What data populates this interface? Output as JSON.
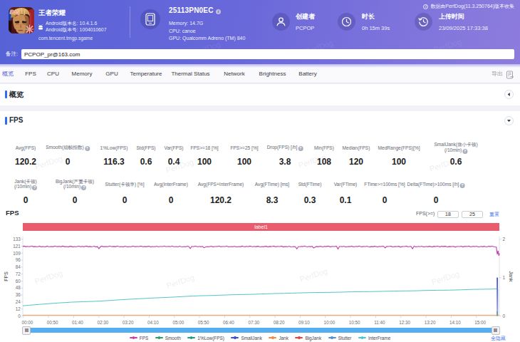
{
  "header": {
    "collect_info": "数据由PerfDog(11.3.250764)版本收集",
    "app": {
      "name": "王者荣耀",
      "version_name_label": "Android版本名: ",
      "version_name": "10.4.1.6",
      "version_code_label": "Android版本号: ",
      "version_code": "1004010607",
      "package": "com.tencent.tmgp.sgame"
    },
    "device": {
      "model": "25113PN0EC",
      "info_badge": "i",
      "memory": "Memory: 14.7G",
      "cpu": "CPU: canoe",
      "gpu": "GPU: Qualcomm Adreno (TM) 840"
    },
    "creator": {
      "label": "创建者",
      "value": "PCPOP"
    },
    "duration": {
      "label": "时长",
      "value": "0h 15m 39s"
    },
    "upload": {
      "label": "上传时间",
      "value": "23/09/2025 17:33:38"
    },
    "remark": {
      "label": "备注:",
      "value": "PCPOP_pr@163.com"
    }
  },
  "nav": {
    "tabs": [
      "概览",
      "FPS",
      "CPU",
      "Memory",
      "GPU",
      "Temperature",
      "Thermal Status",
      "Network",
      "Brightness",
      "Battery"
    ],
    "active_index": 0,
    "export_label": "导出"
  },
  "sections": {
    "overview_title": "概览",
    "fps_title": "FPS"
  },
  "stats": {
    "row1": [
      {
        "label": "Avg(FPS)",
        "value": "120.2"
      },
      {
        "label": "Smooth(稳帧指数)",
        "help": true,
        "value": "0"
      },
      {
        "label": "1%Low(FPS)",
        "value": "116.3"
      },
      {
        "label": "Std(FPS)",
        "value": "0.6"
      },
      {
        "label": "Var(FPS)",
        "value": "0.4"
      },
      {
        "label": "FPS>=18 [%]",
        "value": "100"
      },
      {
        "label": "FPS>=25 [%]",
        "value": "100"
      },
      {
        "label": "Drop(FPS) [/h]",
        "help": true,
        "value": "3.8"
      },
      {
        "label": "Min(FPS)",
        "value": "108"
      },
      {
        "label": "Median(FPS)",
        "value": "120"
      },
      {
        "label": "MedRange(FPS)[%]",
        "value": "100"
      },
      {
        "label": "SmallJank(微小卡顿)",
        "label2": "(/10min)",
        "help": true,
        "value": "0.6"
      }
    ],
    "row2": [
      {
        "label": "Jank(卡顿)",
        "label2": "(/10min)",
        "help": true,
        "value": "0"
      },
      {
        "label": "BigJank(严重卡顿)",
        "label2": "(/10min)",
        "help": true,
        "value": "0"
      },
      {
        "label": "Stutter(卡顿率) [%]",
        "value": "0"
      },
      {
        "label": "Avg(InterFrame)",
        "value": "0"
      },
      {
        "label": "Avg(FPS+InterFrame)",
        "value": "120.2"
      },
      {
        "label": "Avg(FTime) [ms]",
        "value": "8.3"
      },
      {
        "label": "Std(FTime)",
        "value": "0.3"
      },
      {
        "label": "Var(FTime)",
        "value": "0.1"
      },
      {
        "label": "FTime>=100ms [%]",
        "value": "0"
      },
      {
        "label": "Delta(FTime)>100ms [/h]",
        "help": true,
        "value": "0"
      }
    ]
  },
  "chart_controls": {
    "title": "FPS",
    "threshold_label": "FPS(>=)",
    "threshold1": "18",
    "threshold2": "25",
    "reset_label": "重置",
    "hide_all_label": "全隐藏"
  },
  "chart_data": {
    "type": "line",
    "title": "FPS",
    "annotation_band": {
      "text": "label1",
      "color": "#e85c6e"
    },
    "ylabel_left": "FPS",
    "ylabel_right": "Jank",
    "ylim_left": [
      0,
      133
    ],
    "y_ticks_left": [
      0,
      12,
      24,
      36,
      48,
      60,
      72,
      84,
      96,
      109,
      121,
      133
    ],
    "ylim_right": [
      0,
      2
    ],
    "y_ticks_right": [
      0,
      1,
      2
    ],
    "x_ticks": [
      "00:00",
      "00:50",
      "01:40",
      "02:30",
      "03:20",
      "04:10",
      "05:00",
      "05:50",
      "06:40",
      "07:30",
      "08:20",
      "09:10",
      "10:00",
      "10:50",
      "11:40",
      "12:30",
      "13:20",
      "14:10",
      "15:00"
    ],
    "x_tick_interval_s": 50,
    "duration_s": 939,
    "grid": false,
    "legend_position": "bottom",
    "series": [
      {
        "name": "FPS",
        "color": "#c636ae",
        "axis": "left",
        "width": 1.1,
        "x": [
          0,
          3,
          6,
          9,
          12,
          15,
          18,
          21,
          24,
          27,
          30,
          33,
          36,
          39,
          42,
          45,
          48,
          51,
          54,
          57,
          60,
          63,
          66,
          69,
          72,
          75,
          78,
          81,
          84,
          87,
          90,
          93,
          96,
          99,
          102,
          105,
          108,
          111,
          114,
          117,
          120,
          123,
          126,
          129,
          132,
          135,
          138,
          141,
          144,
          147,
          150,
          153,
          156,
          159,
          162,
          165,
          168,
          171,
          174,
          177,
          180,
          183,
          186,
          189,
          192,
          195,
          198,
          201,
          204,
          207,
          210,
          213,
          216,
          219,
          222,
          225,
          228,
          231,
          234,
          237,
          240,
          243,
          246,
          249,
          252,
          255,
          258,
          261,
          264,
          267,
          270,
          273,
          276,
          279,
          282,
          285,
          288,
          291,
          294,
          297,
          300,
          303,
          306,
          309,
          312,
          315,
          318,
          321,
          324,
          327,
          330,
          333,
          336,
          339,
          342,
          345,
          348,
          351,
          354,
          357,
          360,
          363,
          366,
          369,
          372,
          375,
          378,
          381,
          384,
          387,
          390,
          393,
          396,
          399,
          402,
          405,
          408,
          411,
          414,
          417,
          420,
          423,
          426,
          429,
          432,
          435,
          438,
          441,
          444,
          447,
          450,
          453,
          456,
          459,
          462,
          465,
          468,
          471,
          474,
          477,
          480,
          483,
          486,
          489,
          492,
          495,
          498,
          501,
          504,
          507,
          510,
          513,
          516,
          519,
          522,
          525,
          528,
          531,
          534,
          537,
          540,
          543,
          546,
          549,
          552,
          555,
          558,
          561,
          564,
          567,
          570,
          573,
          576,
          579,
          582,
          585,
          588,
          591,
          594,
          597,
          600,
          603,
          606,
          609,
          612,
          615,
          618,
          621,
          624,
          627,
          630,
          633,
          636,
          639,
          642,
          645,
          648,
          651,
          654,
          657,
          660,
          663,
          666,
          669,
          672,
          675,
          678,
          681,
          684,
          687,
          690,
          693,
          696,
          699,
          702,
          705,
          708,
          711,
          714,
          717,
          720,
          723,
          726,
          729,
          732,
          735,
          738,
          741,
          744,
          747,
          750,
          753,
          756,
          759,
          762,
          765,
          768,
          771,
          774,
          777,
          780,
          783,
          786,
          789,
          792,
          795,
          798,
          801,
          804,
          807,
          810,
          813,
          816,
          819,
          822,
          825,
          828,
          831,
          834,
          837,
          840,
          843,
          846,
          849,
          852,
          855,
          858,
          861,
          864,
          867,
          870,
          873,
          876,
          879,
          882,
          885,
          888,
          891,
          894,
          897,
          900,
          903,
          906,
          909,
          912,
          915,
          918,
          921,
          924,
          927,
          930,
          933,
          935,
          936.5,
          938,
          939
        ],
        "values": [
          120.5,
          121.1,
          120.0,
          120.6,
          120.1,
          120.5,
          121.3,
          120.0,
          120.5,
          120.1,
          120.1,
          121.1,
          119.9,
          120.2,
          120.0,
          119.9,
          121.1,
          120.1,
          120.2,
          120.4,
          120.0,
          121.3,
          120.4,
          120.2,
          120.6,
          119.9,
          121.1,
          120.5,
          119.9,
          120.4,
          119.7,
          120.8,
          120.5,
          119.7,
          120.4,
          119.8,
          120.7,
          120.9,
          119.9,
          120.6,
          120.0,
          120.7,
          121.1,
          119.9,
          120.5,
          120.0,
          120.3,
          121.0,
          119.7,
          120.2,
          116.6,
          120.0,
          121.1,
          119.9,
          120.2,
          120.3,
          120.1,
          121.3,
          120.3,
          120.2,
          120.5,
          120.0,
          121.2,
          120.3,
          119.9,
          120.4,
          119.7,
          120.9,
          120.3,
          119.7,
          120.4,
          119.8,
          120.9,
          120.7,
          119.9,
          120.7,
          120.1,
          120.9,
          121.0,
          119.8,
          120.5,
          120.0,
          120.5,
          120.9,
          119.6,
          120.3,
          120.0,
          120.2,
          121.0,
          119.8,
          120.3,
          120.3,
          120.3,
          121.3,
          120.1,
          120.3,
          120.5,
          120.1,
          121.2,
          120.1,
          120.0,
          120.3,
          119.8,
          121.0,
          120.1,
          119.8,
          120.4,
          119.9,
          121.0,
          120.5,
          117.0,
          120.7,
          120.1,
          121.0,
          120.8,
          119.8,
          120.6,
          120.0,
          120.6,
          118.3,
          119.5,
          120.3,
          119.9,
          120.4,
          120.9,
          119.7,
          120.4,
          120.3,
          120.5,
          121.3,
          119.9,
          120.4,
          120.4,
          120.3,
          121.2,
          119.9,
          120.0,
          120.3,
          119.9,
          121.0,
          119.9,
          119.8,
          120.4,
          120.0,
          121.1,
          120.3,
          119.9,
          120.7,
          120.1,
          121.1,
          120.6,
          119.8,
          120.6,
          120.0,
          120.8,
          120.6,
          119.5,
          120.4,
          119.9,
          120.6,
          120.8,
          119.6,
          120.5,
          120.2,
          120.6,
          121.1,
          119.8,
          120.5,
          120.4,
          120.4,
          121.1,
          119.7,
          120.2,
          120.3,
          120.1,
          121.0,
          119.7,
          120.0,
          120.4,
          120.1,
          116.4,
          120.1,
          120.0,
          120.7,
          120.2,
          121.2,
          120.4,
          119.8,
          120.7,
          120.0,
          120.9,
          117.8,
          119.5,
          120.5,
          119.9,
          120.7,
          120.6,
          119.6,
          120.6,
          120.2,
          120.8,
          121.0,
          119.7,
          120.6,
          120.4,
          120.6,
          121.0,
          116.2,
          120.3,
          120.3,
          120.2,
          120.9,
          119.6,
          120.1,
          120.4,
          120.2,
          121.1,
          119.9,
          120.1,
          120.7,
          120.3,
          121.2,
          120.1,
          119.9,
          120.7,
          120.1,
          120.9,
          120.1,
          119.6,
          120.5,
          120.0,
          120.8,
          120.4,
          119.6,
          120.7,
          120.2,
          120.9,
          120.8,
          118.0,
          120.7,
          120.4,
          120.7,
          120.8,
          119.5,
          120.4,
          120.2,
          120.3,
          120.8,
          119.4,
          120.2,
          120.4,
          120.3,
          121.1,
          119.8,
          120.3,
          120.7,
          116.5,
          121.2,
          119.9,
          120.1,
          120.7,
          120.1,
          120.9,
          119.9,
          119.7,
          120.6,
          120.0,
          120.8,
          120.2,
          119.7,
          120.8,
          120.2,
          121.0,
          120.6,
          119.7,
          120.9,
          120.3,
          120.8,
          120.6,
          119.5,
          120.5,
          120.2,
          120.4,
          120.6,
          119.4,
          120.4,
          120.4,
          120.4,
          120.9,
          119.7,
          120.5,
          120.7,
          120.4,
          121.1,
          119.8,
          120.2,
          120.7,
          120.2,
          120.9,
          119.7,
          119.8,
          120.6,
          120.0,
          120.8,
          120.0,
          119.8,
          120.9,
          120.3,
          121.0,
          120.4,
          119.8,
          119.5,
          107.0,
          113.0,
          104.5,
          108.5
        ]
      },
      {
        "name": "InterFrame",
        "color": "#55c3c7",
        "axis": "left",
        "width": 1,
        "x": [
          0,
          12,
          24,
          36,
          48,
          60,
          72,
          84,
          96,
          108,
          120,
          132,
          144,
          156,
          168,
          180,
          192,
          204,
          216,
          228,
          240,
          252,
          264,
          276,
          288,
          300,
          312,
          324,
          336,
          348,
          360,
          372,
          384,
          396,
          408,
          420,
          432,
          444,
          456,
          468,
          480,
          492,
          504,
          516,
          528,
          540,
          552,
          564,
          576,
          588,
          600,
          612,
          624,
          636,
          648,
          660,
          672,
          684,
          696,
          708,
          720,
          732,
          744,
          756,
          768,
          780,
          792,
          804,
          816,
          828,
          840,
          852,
          864,
          876,
          888,
          900,
          912,
          924,
          936,
          935.8
        ],
        "values": [
          17.5,
          18.5,
          19.4,
          20.2,
          21.0,
          21.9,
          22.6,
          23.2,
          23.9,
          24.3,
          24.6,
          25.0,
          25.4,
          25.9,
          26.6,
          27.3,
          28.0,
          28.6,
          29.2,
          29.7,
          30.3,
          30.9,
          31.4,
          31.8,
          32.3,
          32.8,
          33.4,
          34.0,
          34.5,
          35.0,
          35.2,
          35.5,
          35.8,
          36.2,
          36.6,
          36.9,
          37.1,
          37.3,
          37.6,
          38.0,
          38.4,
          38.7,
          39.0,
          39.2,
          39.5,
          39.8,
          40.1,
          40.4,
          40.6,
          40.7,
          40.8,
          41.0,
          41.2,
          41.5,
          41.8,
          41.9,
          42.0,
          42.1,
          42.4,
          42.6,
          42.9,
          43.1,
          43.3,
          43.4,
          43.5,
          43.8,
          44.1,
          44.3,
          44.5,
          44.6,
          44.7,
          45.0,
          45.3,
          45.7,
          46.0,
          46.2,
          46.4,
          46.6,
          47.0,
          1.0
        ]
      },
      {
        "name": "Jank",
        "color": "#f2b079",
        "axis": "right",
        "width": 1.2,
        "x": [
          0,
          939
        ],
        "values": [
          0,
          0
        ],
        "y_offset": -1.0
      },
      {
        "name": "SmallJank",
        "color": "url(#spikeGrad)",
        "axis": "right",
        "width": 1.8,
        "x": [
          935,
          935
        ],
        "values": [
          0,
          1
        ]
      }
    ],
    "legend": [
      {
        "label": "FPS",
        "color": "#d53aa6"
      },
      {
        "label": "Smooth",
        "color": "#2aa05e"
      },
      {
        "label": "1%Low(FPS)",
        "color": "#19a37a"
      },
      {
        "label": "SmallJank",
        "color": "#3b50d5"
      },
      {
        "label": "Jank",
        "color": "#f08a3e"
      },
      {
        "label": "BigJank",
        "color": "#e34545"
      },
      {
        "label": "Stutter",
        "color": "#4f8fe0"
      },
      {
        "label": "InterFrame",
        "color": "#41c8d9"
      }
    ]
  },
  "watermark": "PerfDog"
}
